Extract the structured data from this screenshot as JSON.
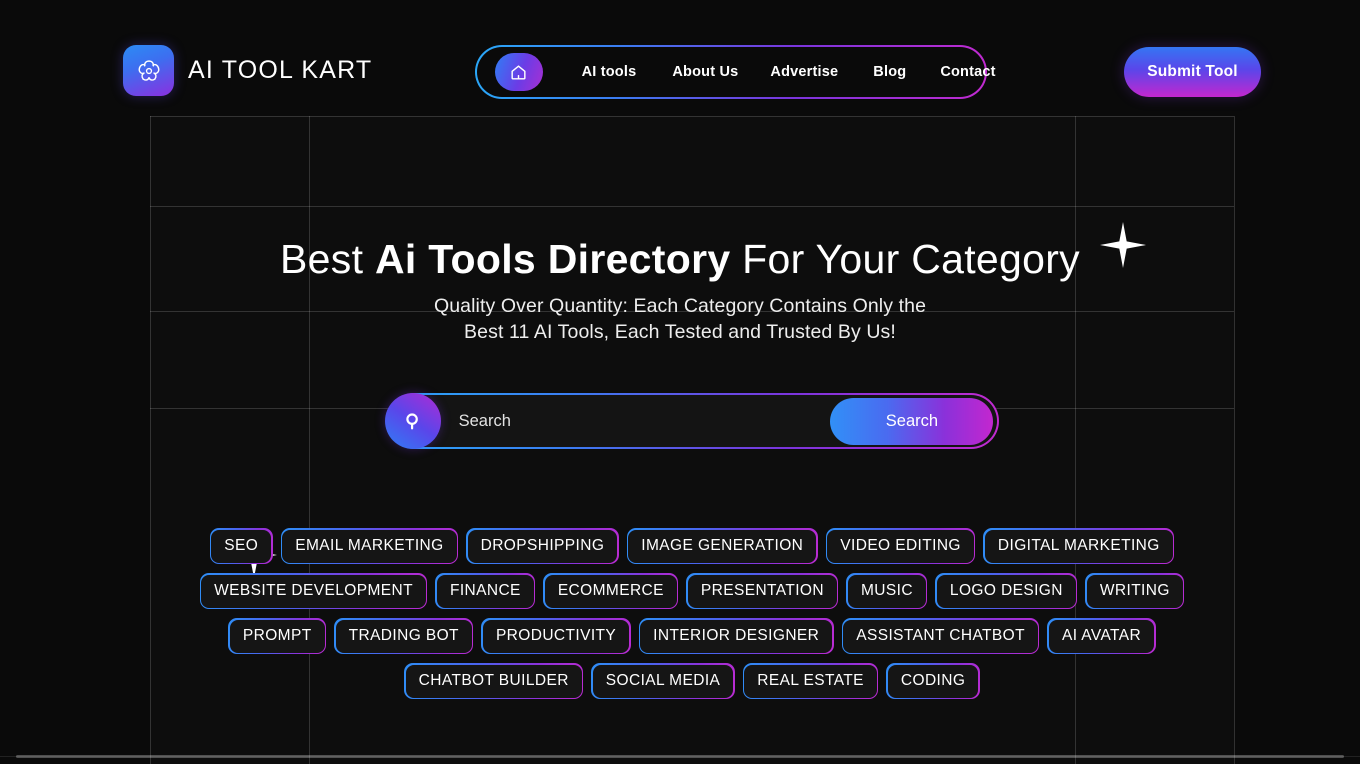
{
  "brand": {
    "name": "AI TOOL KART",
    "logo_icon": "swirl-petal-icon"
  },
  "nav": {
    "home_icon": "home-icon",
    "links": [
      {
        "label": "AI tools"
      },
      {
        "label": "About Us"
      },
      {
        "label": "Advertise"
      },
      {
        "label": "Blog"
      },
      {
        "label": "Contact"
      }
    ]
  },
  "header": {
    "submit_tool_label": "Submit Tool"
  },
  "hero": {
    "headline_pre": "Best ",
    "headline_bold": "Ai Tools Directory",
    "headline_post": " For Your Category",
    "subhead_line1": "Quality Over Quantity: Each Category Contains Only the",
    "subhead_line2": "Best 11 AI Tools, Each Tested and Trusted By Us!"
  },
  "search": {
    "icon": "magnifier-icon",
    "placeholder": "Search",
    "value": "",
    "button_label": "Search"
  },
  "categories": [
    "SEO",
    "EMAIL MARKETING",
    "DROPSHIPPING",
    "IMAGE GENERATION",
    "VIDEO EDITING",
    "DIGITAL MARKETING",
    "WEBSITE DEVELOPMENT",
    "FINANCE",
    "ECOMMERCE",
    "PRESENTATION",
    "MUSIC",
    "LOGO DESIGN",
    "WRITING",
    "PROMPT",
    "TRADING BOT",
    "PRODUCTIVITY",
    "INTERIOR DESIGNER",
    "ASSISTANT CHATBOT",
    "AI AVATAR",
    "CHATBOT BUILDER",
    "SOCIAL MEDIA",
    "REAL ESTATE",
    "CODING"
  ],
  "decorations": {
    "sparkle_right": "sparkle-icon",
    "sparkle_left": "sparkle-icon"
  },
  "colors": {
    "background": "#0a0a0a",
    "panel": "#0d0d0d",
    "gradient_start": "#2aa8f8",
    "gradient_mid": "#5a46ea",
    "gradient_end": "#c22ad0",
    "text": "#ffffff"
  }
}
